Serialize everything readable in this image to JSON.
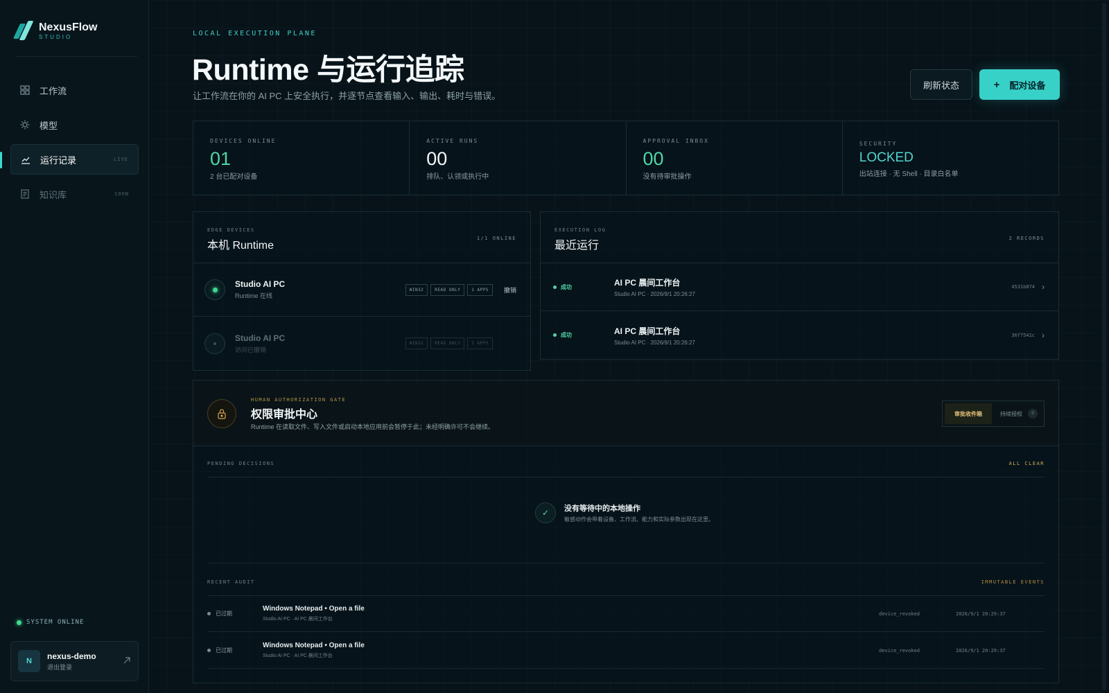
{
  "brand": {
    "name": "NexusFlow",
    "sub": "STUDIO"
  },
  "nav": [
    {
      "label": "工作流",
      "icon": "grid-icon",
      "tag": ""
    },
    {
      "label": "模型",
      "icon": "sun-icon",
      "tag": ""
    },
    {
      "label": "运行记录",
      "icon": "chart-line-icon",
      "tag": "LIVE"
    },
    {
      "label": "知识库",
      "icon": "document-icon",
      "tag": "SOON"
    }
  ],
  "system": {
    "status": "SYSTEM ONLINE"
  },
  "user": {
    "initial": "N",
    "name": "nexus-demo",
    "sub": "退出登录"
  },
  "header": {
    "eyebrow": "LOCAL EXECUTION PLANE",
    "title": "Runtime 与运行追踪",
    "subtitle": "让工作流在你的 AI PC 上安全执行，并逐节点查看输入、输出、耗时与错误。",
    "refresh_label": "刷新状态",
    "pair_label": "配对设备",
    "pair_icon": "+"
  },
  "stats": [
    {
      "label": "DEVICES ONLINE",
      "value": "01",
      "note": "2 台已配对设备"
    },
    {
      "label": "ACTIVE RUNS",
      "value": "00",
      "note": "排队、认领或执行中"
    },
    {
      "label": "APPROVAL INBOX",
      "value": "00",
      "note": "没有待审批操作"
    },
    {
      "label": "SECURITY",
      "value": "LOCKED",
      "note": "出站连接 · 无 Shell · 目录白名单"
    }
  ],
  "devices": {
    "eyebrow": "EDGE DEVICES",
    "title": "本机 Runtime",
    "count": "1/1 ONLINE",
    "rows": [
      {
        "name": "Studio AI PC",
        "sub": "Runtime 在线",
        "chips": [
          "WIN32",
          "READ ONLY",
          "1 APPS"
        ],
        "action": "撤销"
      },
      {
        "name": "Studio AI PC",
        "sub": "访问已撤销",
        "chips": [
          "WIN32",
          "READ ONLY",
          "1 APPS"
        ],
        "action": ""
      }
    ]
  },
  "runs": {
    "eyebrow": "EXECUTION LOG",
    "title": "最近运行",
    "count": "2 RECORDS",
    "rows": [
      {
        "status": "成功",
        "name": "AI PC 晨间工作台",
        "sub": "Studio AI PC · 2026/9/1 20:26:27",
        "id": "4531b874"
      },
      {
        "status": "成功",
        "name": "AI PC 晨间工作台",
        "sub": "Studio AI PC · 2026/9/1 20:26:27",
        "id": "36f7541c"
      }
    ]
  },
  "approval": {
    "eyebrow": "HUMAN AUTHORIZATION GATE",
    "title": "权限审批中心",
    "desc": "Runtime 在读取文件、写入文件或启动本地应用前会暂停于此；未经明确许可不会继续。",
    "tab_inbox": "审批收件箱",
    "tab_grants": "持续授权",
    "grants_count": "0",
    "pending_label": "PENDING DECISIONS",
    "pending_status": "ALL CLEAR",
    "empty_title": "没有等待中的本地操作",
    "empty_sub": "敏感动作会带着设备、工作流、能力和实际参数出现在这里。",
    "audit_label": "RECENT AUDIT",
    "audit_tag": "IMMUTABLE EVENTS",
    "audit": [
      {
        "status": "已过期",
        "title": "Windows Notepad • Open a file",
        "sub": "Studio AI PC · AI PC 晨间工作台",
        "event": "device_revoked",
        "time": "2026/9/1 20:29:37"
      },
      {
        "status": "已过期",
        "title": "Windows Notepad • Open a file",
        "sub": "Studio AI PC · AI PC 晨间工作台",
        "event": "device_revoked",
        "time": "2026/9/1 20:29:37"
      }
    ]
  },
  "colors": {
    "accent": "#38d1c8",
    "success": "#4fd6a6",
    "warning": "#d6a450",
    "background": "#071319"
  }
}
